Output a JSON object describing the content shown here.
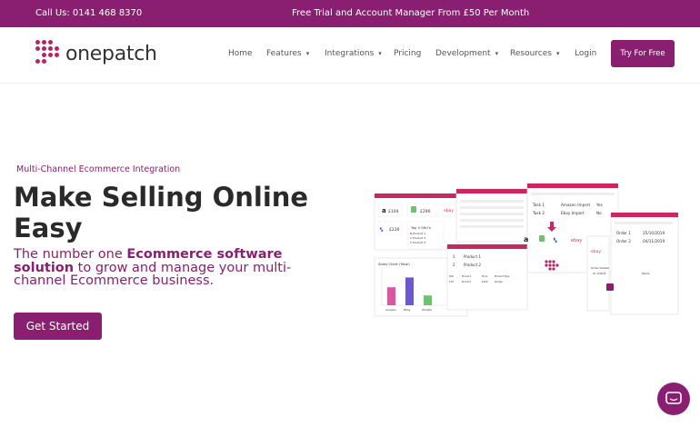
{
  "topbar": {
    "phone": "Call Us: 0141 468 8370",
    "promo": "Free Trial and Account Manager From £50 Per Month"
  },
  "brand": {
    "name": "onepatch",
    "color": "#8a1e70",
    "dot_color": "#b8245f"
  },
  "nav": {
    "items": [
      {
        "label": "Home",
        "has_dropdown": false
      },
      {
        "label": "Features",
        "has_dropdown": true
      },
      {
        "label": "Integrations",
        "has_dropdown": true
      },
      {
        "label": "Pricing",
        "has_dropdown": false
      },
      {
        "label": "Development",
        "has_dropdown": true
      },
      {
        "label": "Resources",
        "has_dropdown": true
      },
      {
        "label": "Login",
        "has_dropdown": false
      }
    ],
    "cta": "Try For Free"
  },
  "hero": {
    "eyebrow": "Multi-Channel Ecommerce Integration",
    "headline": "Make Selling Online Easy",
    "sub_prefix": "The number one ",
    "sub_bold": "Ecommerce software solution",
    "sub_suffix": " to grow and manage your multi-channel Ecommerce business.",
    "button": "Get Started"
  },
  "illustration": {
    "marketplace_prices": [
      "£104",
      "£290",
      "£230"
    ],
    "top_skus_title": "Top 5 SKU's",
    "top_skus": [
      "Product 1",
      "Product 2",
      "Product 3"
    ],
    "sales_chart_title": "Sales Chart (Total)",
    "sales_chart_bars": [
      {
        "label": "Amazon",
        "value": 0.55,
        "color": "#d9579e"
      },
      {
        "label": "Ebay",
        "value": 0.85,
        "color": "#6a5acd"
      },
      {
        "label": "Shopify",
        "value": 0.3,
        "color": "#6cc36c"
      }
    ],
    "products": [
      {
        "idx": "1",
        "name": "Product 1"
      },
      {
        "idx": "2",
        "name": "Product 2"
      }
    ],
    "product_table_headers": [
      "SKU",
      "Product",
      "Price",
      "Product Type",
      "Integrations"
    ],
    "product_table_row": [
      "123",
      "Product",
      "£100",
      "Simple"
    ],
    "tasks": [
      {
        "name": "Task 1",
        "value": "Amazon Import"
      },
      {
        "name": "Task 2",
        "value": "Ebay Import"
      }
    ],
    "task_status": [
      "Yes",
      "No"
    ],
    "orders": [
      {
        "name": "Order 1",
        "date": "25/10/2019"
      },
      {
        "name": "Order 2",
        "date": "04/11/2019"
      }
    ],
    "order_details_title": "Order Details",
    "order_items_title": "Items",
    "order_id": "ID: 123645"
  },
  "colors": {
    "accent": "#8a1e70",
    "card_header": "#c9275d"
  }
}
